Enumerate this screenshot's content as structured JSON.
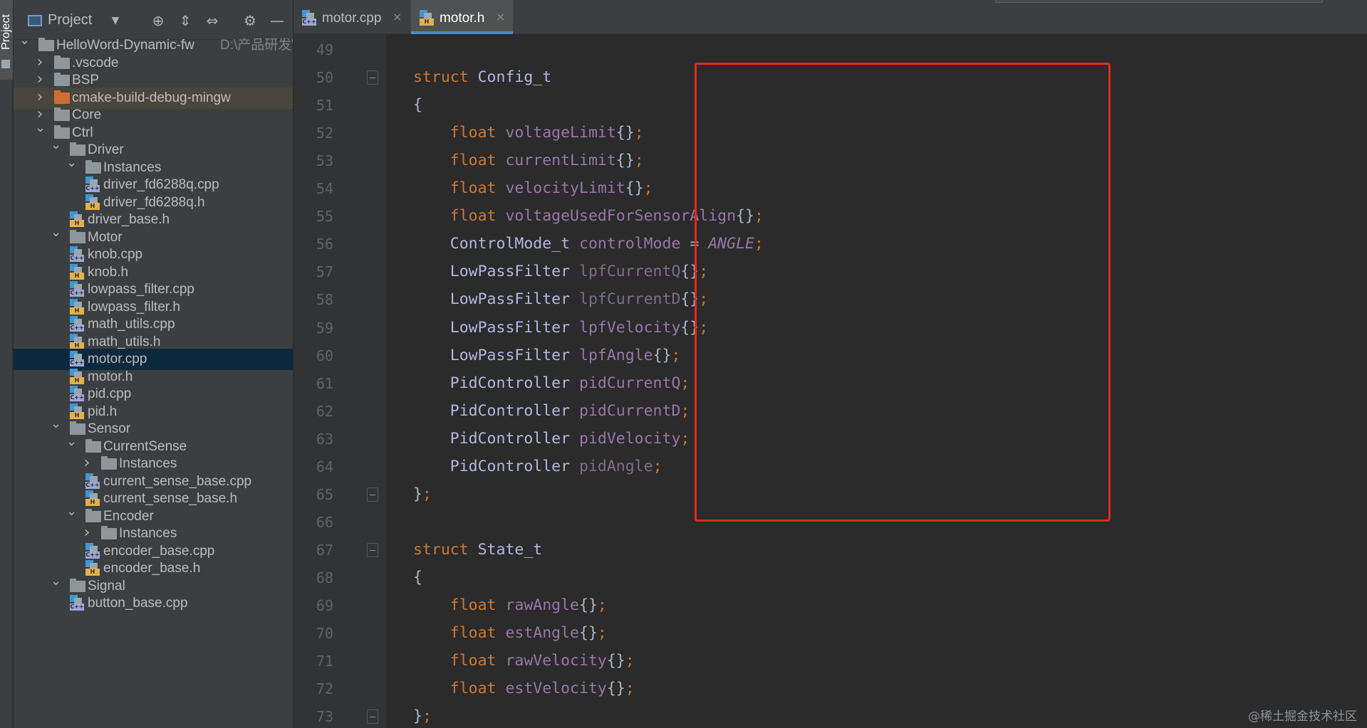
{
  "toolwindow": {
    "vertical_tab_label": "Project"
  },
  "project_panel": {
    "title": "Project",
    "header_icons": [
      "locate-icon",
      "expand-all-icon",
      "collapse-all-icon",
      "gear-icon",
      "minimize-icon"
    ],
    "tree": [
      {
        "label": "HelloWord-Dynamic-fw",
        "hint": "D:\\产品研发\\",
        "kind": "folder",
        "depth": 0,
        "expanded": true
      },
      {
        "label": ".vscode",
        "kind": "folder",
        "depth": 1,
        "expanded": false
      },
      {
        "label": "BSP",
        "kind": "folder",
        "depth": 1,
        "expanded": false
      },
      {
        "label": "cmake-build-debug-mingw",
        "kind": "folder-excluded",
        "depth": 1,
        "expanded": false
      },
      {
        "label": "Core",
        "kind": "folder",
        "depth": 1,
        "expanded": false
      },
      {
        "label": "Ctrl",
        "kind": "folder",
        "depth": 1,
        "expanded": true
      },
      {
        "label": "Driver",
        "kind": "folder",
        "depth": 2,
        "expanded": true
      },
      {
        "label": "Instances",
        "kind": "folder",
        "depth": 3,
        "expanded": true
      },
      {
        "label": "driver_fd6288q.cpp",
        "kind": "cpp",
        "depth": 4
      },
      {
        "label": "driver_fd6288q.h",
        "kind": "h",
        "depth": 4
      },
      {
        "label": "driver_base.h",
        "kind": "h",
        "depth": 3
      },
      {
        "label": "Motor",
        "kind": "folder",
        "depth": 2,
        "expanded": true
      },
      {
        "label": "knob.cpp",
        "kind": "cpp",
        "depth": 3
      },
      {
        "label": "knob.h",
        "kind": "h",
        "depth": 3
      },
      {
        "label": "lowpass_filter.cpp",
        "kind": "cpp",
        "depth": 3
      },
      {
        "label": "lowpass_filter.h",
        "kind": "h",
        "depth": 3
      },
      {
        "label": "math_utils.cpp",
        "kind": "cpp",
        "depth": 3
      },
      {
        "label": "math_utils.h",
        "kind": "h",
        "depth": 3
      },
      {
        "label": "motor.cpp",
        "kind": "cpp",
        "depth": 3,
        "selected": true
      },
      {
        "label": "motor.h",
        "kind": "h",
        "depth": 3
      },
      {
        "label": "pid.cpp",
        "kind": "cpp",
        "depth": 3
      },
      {
        "label": "pid.h",
        "kind": "h",
        "depth": 3
      },
      {
        "label": "Sensor",
        "kind": "folder",
        "depth": 2,
        "expanded": true
      },
      {
        "label": "CurrentSense",
        "kind": "folder",
        "depth": 3,
        "expanded": true
      },
      {
        "label": "Instances",
        "kind": "folder",
        "depth": 4,
        "expanded": false
      },
      {
        "label": "current_sense_base.cpp",
        "kind": "cpp",
        "depth": 4
      },
      {
        "label": "current_sense_base.h",
        "kind": "h",
        "depth": 4
      },
      {
        "label": "Encoder",
        "kind": "folder",
        "depth": 3,
        "expanded": true
      },
      {
        "label": "Instances",
        "kind": "folder",
        "depth": 4,
        "expanded": false
      },
      {
        "label": "encoder_base.cpp",
        "kind": "cpp",
        "depth": 4
      },
      {
        "label": "encoder_base.h",
        "kind": "h",
        "depth": 4
      },
      {
        "label": "Signal",
        "kind": "folder",
        "depth": 2,
        "expanded": true
      },
      {
        "label": "button_base.cpp",
        "kind": "cpp",
        "depth": 3
      }
    ]
  },
  "editor": {
    "tabs": [
      {
        "label": "motor.cpp",
        "kind": "cpp",
        "active": false
      },
      {
        "label": "motor.h",
        "kind": "h",
        "active": true
      }
    ],
    "lines": [
      {
        "n": "49",
        "fold": false,
        "tokens": []
      },
      {
        "n": "50",
        "fold": true,
        "tokens": [
          [
            "kw",
            "struct "
          ],
          [
            "ty",
            "Config_t"
          ]
        ]
      },
      {
        "n": "51",
        "fold": false,
        "tokens": [
          [
            "pl",
            "{"
          ]
        ]
      },
      {
        "n": "52",
        "fold": false,
        "tokens": [
          [
            "kw",
            "    float "
          ],
          [
            "fld",
            "voltageLimit"
          ],
          [
            "pl",
            "{}"
          ],
          [
            "kw",
            ";"
          ]
        ]
      },
      {
        "n": "53",
        "fold": false,
        "tokens": [
          [
            "kw",
            "    float "
          ],
          [
            "fld",
            "currentLimit"
          ],
          [
            "pl",
            "{}"
          ],
          [
            "kw",
            ";"
          ]
        ]
      },
      {
        "n": "54",
        "fold": false,
        "tokens": [
          [
            "kw",
            "    float "
          ],
          [
            "fld",
            "velocityLimit"
          ],
          [
            "pl",
            "{}"
          ],
          [
            "kw",
            ";"
          ]
        ]
      },
      {
        "n": "55",
        "fold": false,
        "tokens": [
          [
            "kw",
            "    float "
          ],
          [
            "fld",
            "voltageUsedForSensorAlign"
          ],
          [
            "pl",
            "{}"
          ],
          [
            "kw",
            ";"
          ]
        ]
      },
      {
        "n": "56",
        "fold": false,
        "tokens": [
          [
            "ty",
            "    ControlMode_t "
          ],
          [
            "fld",
            "controlMode"
          ],
          [
            "pl",
            " = "
          ],
          [
            "en",
            "ANGLE"
          ],
          [
            "kw",
            ";"
          ]
        ]
      },
      {
        "n": "57",
        "fold": false,
        "tokens": [
          [
            "ty",
            "    LowPassFilter "
          ],
          [
            "dim",
            "lpfCurrentQ"
          ],
          [
            "pl",
            "{}"
          ],
          [
            "kw",
            ";"
          ]
        ]
      },
      {
        "n": "58",
        "fold": false,
        "tokens": [
          [
            "ty",
            "    LowPassFilter "
          ],
          [
            "dim",
            "lpfCurrentD"
          ],
          [
            "pl",
            "{}"
          ],
          [
            "kw",
            ";"
          ]
        ]
      },
      {
        "n": "59",
        "fold": false,
        "tokens": [
          [
            "ty",
            "    LowPassFilter "
          ],
          [
            "fld",
            "lpfVelocity"
          ],
          [
            "pl",
            "{}"
          ],
          [
            "kw",
            ";"
          ]
        ]
      },
      {
        "n": "60",
        "fold": false,
        "tokens": [
          [
            "ty",
            "    LowPassFilter "
          ],
          [
            "fld",
            "lpfAngle"
          ],
          [
            "pl",
            "{}"
          ],
          [
            "kw",
            ";"
          ]
        ]
      },
      {
        "n": "61",
        "fold": false,
        "tokens": [
          [
            "ty",
            "    PidController "
          ],
          [
            "fld",
            "pidCurrentQ"
          ],
          [
            "kw",
            ";"
          ]
        ]
      },
      {
        "n": "62",
        "fold": false,
        "tokens": [
          [
            "ty",
            "    PidController "
          ],
          [
            "fld",
            "pidCurrentD"
          ],
          [
            "kw",
            ";"
          ]
        ]
      },
      {
        "n": "63",
        "fold": false,
        "tokens": [
          [
            "ty",
            "    PidController "
          ],
          [
            "fld",
            "pidVelocity"
          ],
          [
            "kw",
            ";"
          ]
        ]
      },
      {
        "n": "64",
        "fold": false,
        "tokens": [
          [
            "ty",
            "    PidController "
          ],
          [
            "dim",
            "pidAngle"
          ],
          [
            "kw",
            ";"
          ]
        ]
      },
      {
        "n": "65",
        "fold": true,
        "tokens": [
          [
            "pl",
            "}"
          ],
          [
            "kw",
            ";"
          ]
        ]
      },
      {
        "n": "66",
        "fold": false,
        "tokens": []
      },
      {
        "n": "67",
        "fold": true,
        "tokens": [
          [
            "kw",
            "struct "
          ],
          [
            "ty",
            "State_t"
          ]
        ]
      },
      {
        "n": "68",
        "fold": false,
        "tokens": [
          [
            "pl",
            "{"
          ]
        ]
      },
      {
        "n": "69",
        "fold": false,
        "tokens": [
          [
            "kw",
            "    float "
          ],
          [
            "fld",
            "rawAngle"
          ],
          [
            "pl",
            "{}"
          ],
          [
            "kw",
            ";"
          ]
        ]
      },
      {
        "n": "70",
        "fold": false,
        "tokens": [
          [
            "kw",
            "    float "
          ],
          [
            "fld",
            "estAngle"
          ],
          [
            "pl",
            "{}"
          ],
          [
            "kw",
            ";"
          ]
        ]
      },
      {
        "n": "71",
        "fold": false,
        "tokens": [
          [
            "kw",
            "    float "
          ],
          [
            "fld",
            "rawVelocity"
          ],
          [
            "pl",
            "{}"
          ],
          [
            "kw",
            ";"
          ]
        ]
      },
      {
        "n": "72",
        "fold": false,
        "tokens": [
          [
            "kw",
            "    float "
          ],
          [
            "fld",
            "estVelocity"
          ],
          [
            "pl",
            "{}"
          ],
          [
            "kw",
            ";"
          ]
        ]
      },
      {
        "n": "73",
        "fold": true,
        "tokens": [
          [
            "pl",
            "}"
          ],
          [
            "kw",
            ";"
          ]
        ]
      }
    ]
  },
  "watermark": "@稀土掘金技术社区",
  "colors": {
    "editor_bg": "#2b2b2b",
    "panel_bg": "#3c3f41",
    "keyword": "#cc7832",
    "field": "#9876aa",
    "highlight_box": "#e5281c",
    "selection": "#0d293e"
  }
}
